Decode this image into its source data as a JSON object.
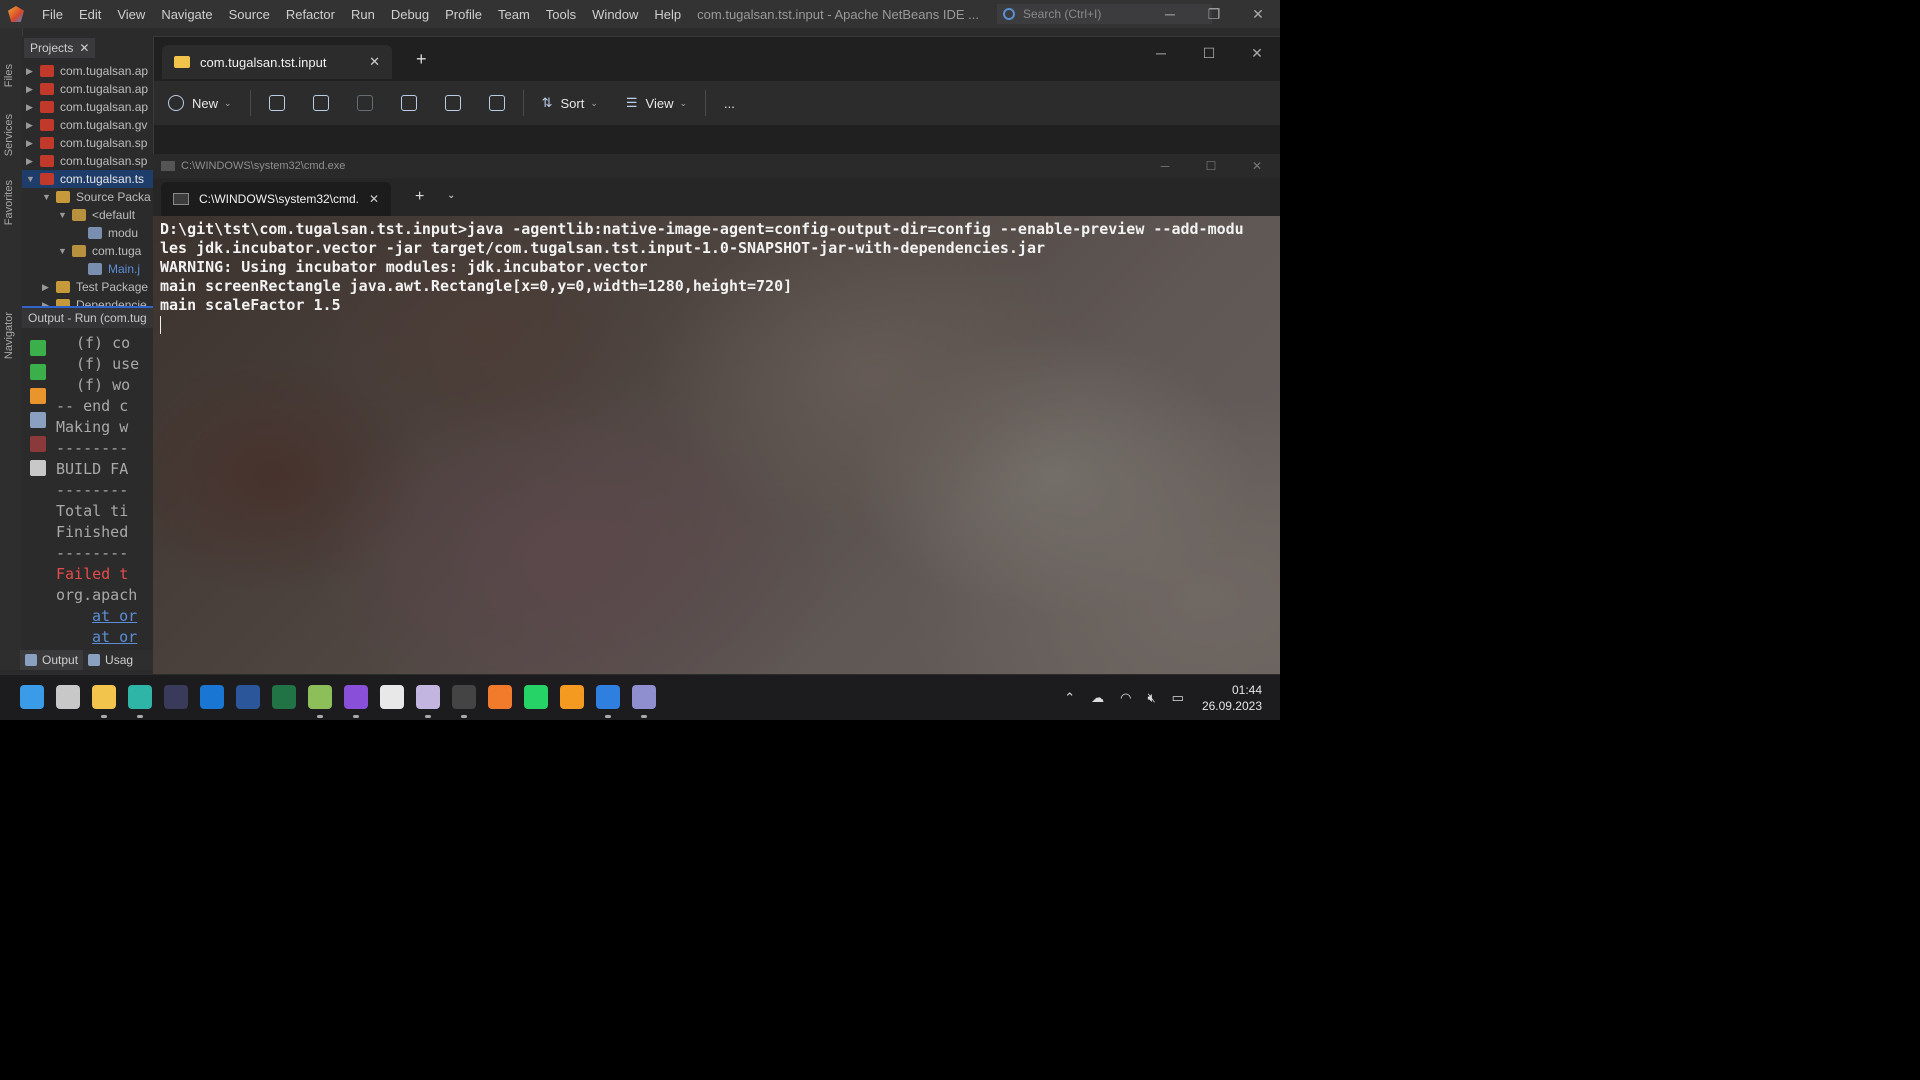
{
  "netbeans": {
    "menu": [
      "File",
      "Edit",
      "View",
      "Navigate",
      "Source",
      "Refactor",
      "Run",
      "Debug",
      "Profile",
      "Team",
      "Tools",
      "Window",
      "Help"
    ],
    "title": "com.tugalsan.tst.input - Apache NetBeans IDE ...",
    "search_placeholder": "Search (Ctrl+I)",
    "side_labels": [
      "Files",
      "Services",
      "Favorites",
      "Navigator"
    ],
    "projects_tab": "Projects",
    "tree": [
      {
        "label": "com.tugalsan.ap",
        "icon": "project-icon"
      },
      {
        "label": "com.tugalsan.ap",
        "icon": "project-icon"
      },
      {
        "label": "com.tugalsan.ap",
        "icon": "project-icon"
      },
      {
        "label": "com.tugalsan.gv",
        "icon": "project-icon"
      },
      {
        "label": "com.tugalsan.sp",
        "icon": "project-icon"
      },
      {
        "label": "com.tugalsan.sp",
        "icon": "project-icon"
      },
      {
        "label": "com.tugalsan.ts",
        "icon": "project-icon"
      },
      {
        "label": "Source Packa",
        "icon": "folder-icon"
      },
      {
        "label": "<default",
        "icon": "package-icon"
      },
      {
        "label": "modu",
        "icon": "file-icon"
      },
      {
        "label": "com.tuga",
        "icon": "package-icon"
      },
      {
        "label": "Main.j",
        "icon": "file-icon"
      },
      {
        "label": "Test Package",
        "icon": "folder-icon"
      },
      {
        "label": "Dependencie",
        "icon": "folder-icon"
      }
    ],
    "output_header": "Output - Run (com.tug",
    "output_lines": [
      {
        "text": "(f) co",
        "kind": "normal"
      },
      {
        "text": "(f) use",
        "kind": "normal"
      },
      {
        "text": "(f) wo",
        "kind": "normal"
      },
      {
        "text": "-- end c",
        "kind": "normal"
      },
      {
        "text": "Making w",
        "kind": "normal"
      },
      {
        "text": "--------",
        "kind": "normal"
      },
      {
        "text": "BUILD FA",
        "kind": "normal"
      },
      {
        "text": "--------",
        "kind": "normal"
      },
      {
        "text": "Total ti",
        "kind": "normal"
      },
      {
        "text": "Finished",
        "kind": "normal"
      },
      {
        "text": "--------",
        "kind": "normal"
      },
      {
        "text": "Failed t",
        "kind": "err"
      },
      {
        "text": "org.apach",
        "kind": "normal"
      },
      {
        "text": "at or",
        "kind": "link"
      },
      {
        "text": "at or",
        "kind": "link"
      }
    ],
    "bottom_tabs": [
      "Output",
      "Usag"
    ]
  },
  "explorer": {
    "tab_title": "com.tugalsan.tst.input",
    "toolbar": {
      "new": "New",
      "sort": "Sort",
      "view": "View",
      "more": "..."
    }
  },
  "cmd": {
    "window_title": "C:\\WINDOWS\\system32\\cmd.exe",
    "tab_title": "C:\\WINDOWS\\system32\\cmd.",
    "lines": [
      "D:\\git\\tst\\com.tugalsan.tst.input>java -agentlib:native-image-agent=config-output-dir=config --enable-preview --add-modu",
      "les jdk.incubator.vector -jar target/com.tugalsan.tst.input-1.0-SNAPSHOT-jar-with-dependencies.jar",
      "WARNING: Using incubator modules: jdk.incubator.vector",
      "main screenRectangle java.awt.Rectangle[x=0,y=0,width=1280,height=720]",
      "main scaleFactor 1.5"
    ]
  },
  "taskbar": {
    "apps": [
      {
        "name": "start-button",
        "color": "#3a9be8",
        "running": false
      },
      {
        "name": "task-view-icon",
        "color": "#c8c8c8",
        "running": false
      },
      {
        "name": "file-explorer-icon",
        "color": "#f3c44c",
        "running": true
      },
      {
        "name": "edge-icon",
        "color": "#2fb5a8",
        "running": true
      },
      {
        "name": "camera-app-icon",
        "color": "#3a3a5a",
        "running": false
      },
      {
        "name": "outlook-icon",
        "color": "#1976d2",
        "running": false
      },
      {
        "name": "word-icon",
        "color": "#2b579a",
        "running": false
      },
      {
        "name": "excel-icon",
        "color": "#217346",
        "running": false
      },
      {
        "name": "notepad-icon",
        "color": "#8cbf5a",
        "running": true
      },
      {
        "name": "github-desktop-icon",
        "color": "#8a4fd8",
        "running": true
      },
      {
        "name": "github-icon",
        "color": "#e8e8e8",
        "running": false
      },
      {
        "name": "netbeans-icon",
        "color": "#c2b6e0",
        "running": true
      },
      {
        "name": "terminal-icon",
        "color": "#444444",
        "running": true
      },
      {
        "name": "xampp-icon",
        "color": "#f27b2b",
        "running": false
      },
      {
        "name": "whatsapp-icon",
        "color": "#25d366",
        "running": false
      },
      {
        "name": "sublime-icon",
        "color": "#f59a20",
        "running": false
      },
      {
        "name": "todo-icon",
        "color": "#2f7fe0",
        "running": true
      },
      {
        "name": "calculator-icon",
        "color": "#8f8fd0",
        "running": true
      }
    ],
    "time": "01:44",
    "date": "26.09.2023"
  }
}
